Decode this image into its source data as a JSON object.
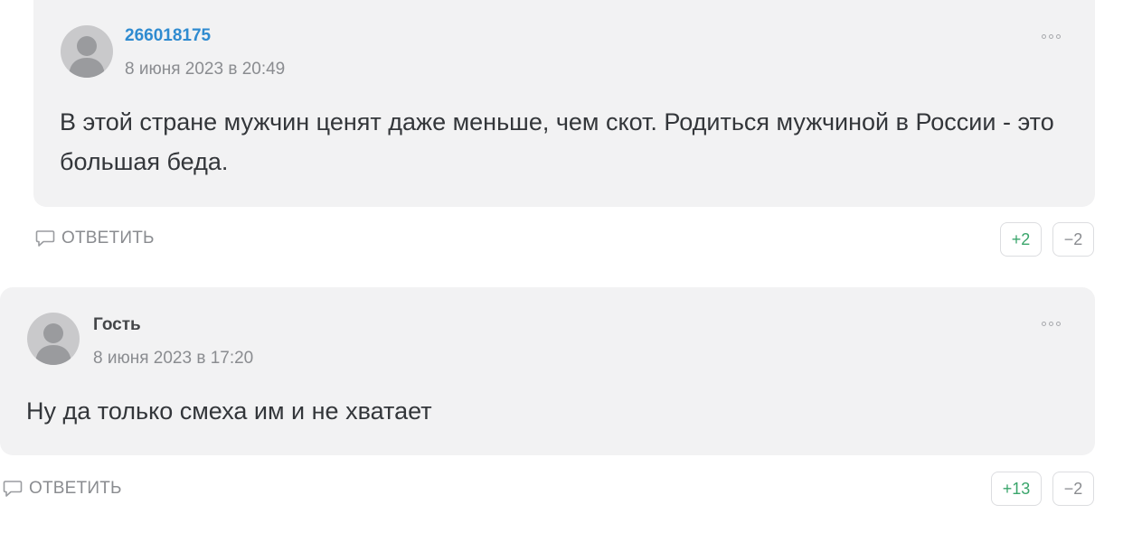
{
  "comments": [
    {
      "author": "266018175",
      "date": "8 июня 2023 в 20:49",
      "text": "В этой стране мужчин ценят даже меньше, чем скот. Родиться мужчиной в России - это большая беда.",
      "reply_label": "ОТВЕТИТЬ",
      "upvotes": "+2",
      "downvotes": "−2"
    },
    {
      "author": "Гость",
      "date": "8 июня 2023 в 17:20",
      "text": "Ну да только смеха им и не хватает",
      "reply_label": "ОТВЕТИТЬ",
      "upvotes": "+13",
      "downvotes": "−2"
    }
  ],
  "icons": {
    "avatar": "user-silhouette-icon",
    "more": "more-options-icon",
    "reply": "speech-bubble-icon"
  },
  "colors": {
    "card_bg": "#f2f2f3",
    "author_link": "#2f8bd0",
    "upvote": "#3aa56b",
    "muted": "#8a8c90"
  }
}
